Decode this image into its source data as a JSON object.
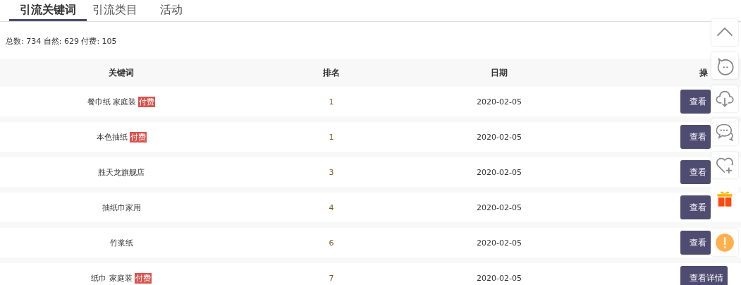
{
  "tabs": [
    {
      "label": "引流关键词",
      "selected": true
    },
    {
      "label": "引流类目",
      "selected": false
    },
    {
      "label": "活动",
      "selected": false
    }
  ],
  "summary": "总数: 734 自然: 629 付费: 105",
  "table": {
    "columns": [
      "关键词",
      "排名",
      "日期",
      "操"
    ],
    "rows": [
      {
        "keyword": "餐巾纸 家庭装",
        "tag": "付费",
        "rank": "1",
        "date": "2020-02-05",
        "action": "查看"
      },
      {
        "keyword": "本色抽纸",
        "tag": "付费",
        "rank": "1",
        "date": "2020-02-05",
        "action": "查看"
      },
      {
        "keyword": "胜天龙旗舰店",
        "rank": "3",
        "date": "2020-02-05",
        "action": "查看"
      },
      {
        "keyword": "抽纸巾家用",
        "rank": "4",
        "date": "2020-02-05",
        "action": "查看"
      },
      {
        "keyword": "竹浆纸",
        "rank": "6",
        "date": "2020-02-05",
        "action": "查看"
      },
      {
        "keyword": "纸巾 家庭装",
        "tag": "付费",
        "rank": "7",
        "date": "2020-02-05",
        "action": "查看详情"
      }
    ]
  },
  "float_bar": [
    {
      "kind": "up"
    },
    {
      "kind": "face"
    },
    {
      "kind": "cloud"
    },
    {
      "kind": "chat"
    },
    {
      "kind": "heart"
    },
    {
      "kind": "gift"
    },
    {
      "kind": "alert"
    }
  ]
}
